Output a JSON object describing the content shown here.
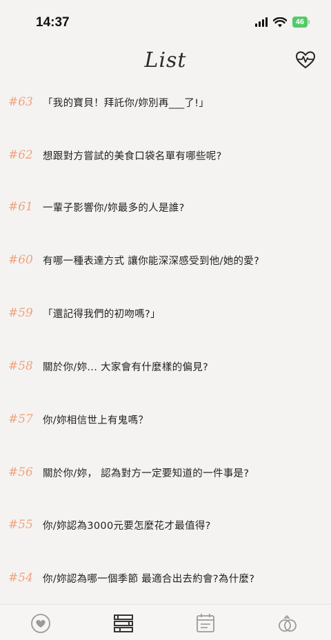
{
  "status": {
    "time": "14:37",
    "battery": "46"
  },
  "header": {
    "title": "List"
  },
  "questions": [
    {
      "num": "#63",
      "text": "「我的寶貝！拜託你/妳別再___了!」"
    },
    {
      "num": "#62",
      "text": "想跟對方嘗試的美食口袋名單有哪些呢?"
    },
    {
      "num": "#61",
      "text": "一輩子影響你/妳最多的人是誰?"
    },
    {
      "num": "#60",
      "text": "有哪一種表達方式 讓你能深深感受到他/她的愛?"
    },
    {
      "num": "#59",
      "text": "「還記得我們的初吻嗎?」"
    },
    {
      "num": "#58",
      "text": "關於你/妳... 大家會有什麼樣的偏見?"
    },
    {
      "num": "#57",
      "text": "你/妳相信世上有鬼嗎？"
    },
    {
      "num": "#56",
      "text": "關於你/妳， 認為對方一定要知道的一件事是?"
    },
    {
      "num": "#55",
      "text": "你/妳認為3000元要怎麼花才最值得?"
    },
    {
      "num": "#54",
      "text": "你/妳認為哪一個季節 最適合出去約會?為什麼?"
    }
  ],
  "tabs": [
    {
      "name": "heart-tab",
      "icon": "heart-circle-icon"
    },
    {
      "name": "list-tab",
      "icon": "books-icon",
      "active": true
    },
    {
      "name": "calendar-tab",
      "icon": "calendar-icon"
    },
    {
      "name": "rings-tab",
      "icon": "rings-icon"
    }
  ],
  "colors": {
    "accent": "#f0a27e",
    "background": "#f4f3f1",
    "text": "#222222"
  }
}
